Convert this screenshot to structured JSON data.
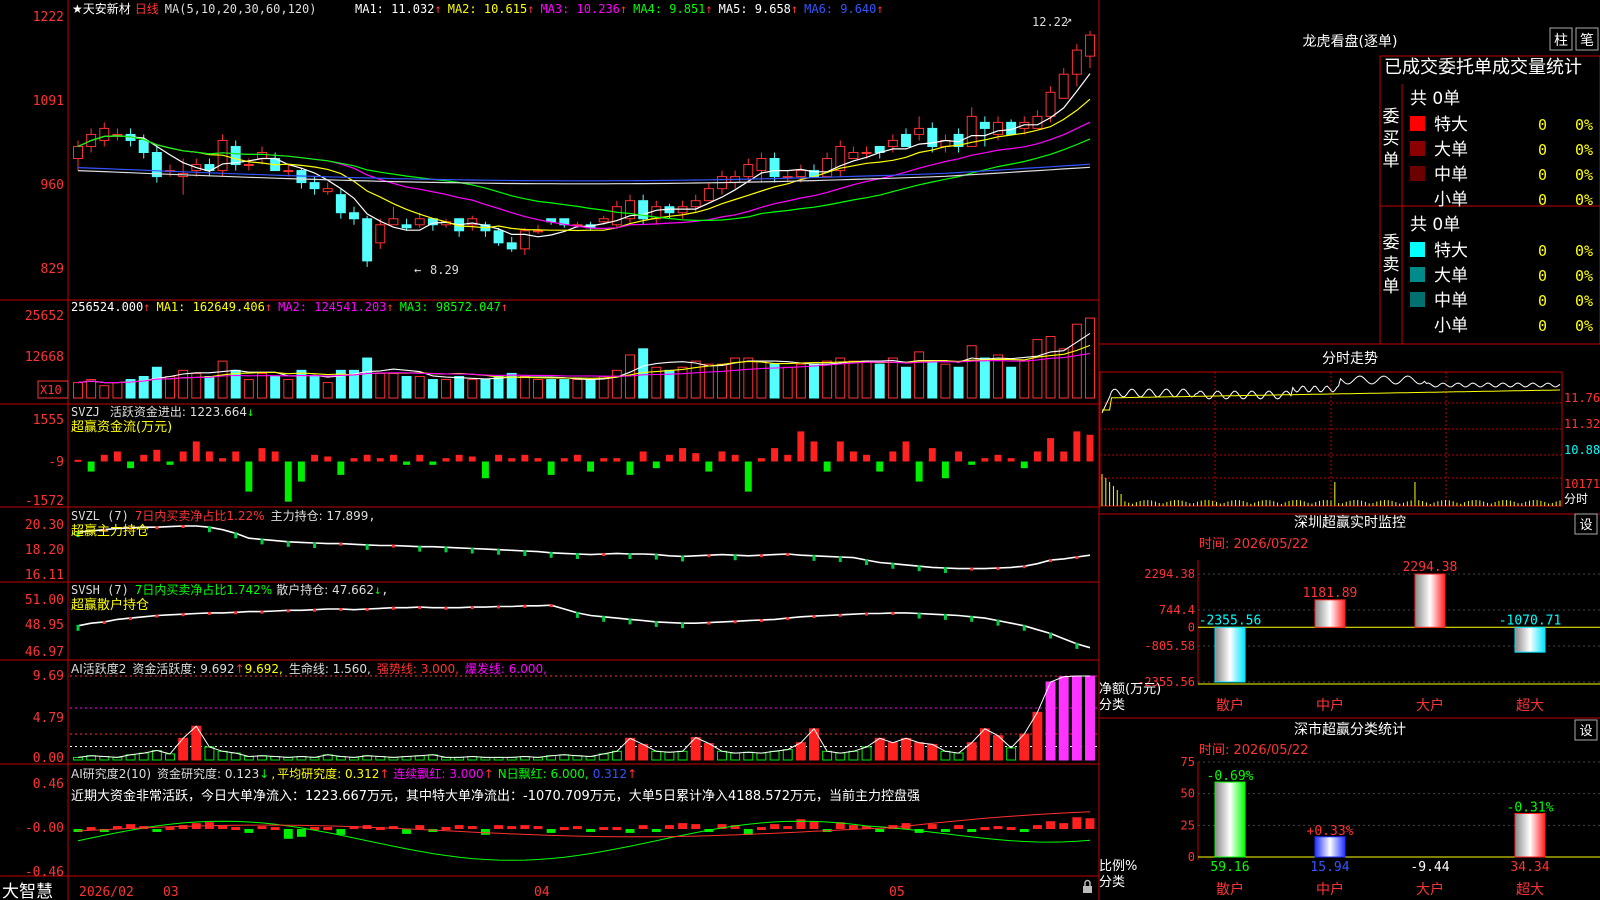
{
  "stock": {
    "name": "★天安新材",
    "period": "日线"
  },
  "main_panel": {
    "indicator": "MA(5,10,20,30,60,120)",
    "ma_labels": [
      {
        "text": "MA1: 11.032",
        "color": "#ffffff"
      },
      {
        "text": "MA2: 10.615",
        "color": "#ffff00"
      },
      {
        "text": "MA3: 10.236",
        "color": "#ff00ff"
      },
      {
        "text": "MA4: 9.851",
        "color": "#00ff00"
      },
      {
        "text": "MA5: 9.658",
        "color": "#ffffff"
      },
      {
        "text": "MA6: 9.640",
        "color": "#3355ff"
      }
    ],
    "high_label": "12.22",
    "low_label": "8.29",
    "y_ticks": [
      "1222",
      "1091",
      "960",
      "829"
    ]
  },
  "vol_panel": {
    "indicator": "VOL(5,10,20)",
    "values": [
      {
        "text": "256524.000",
        "color": "#ffffff"
      },
      {
        "text": "MA1: 162649.406",
        "color": "#ffff00"
      },
      {
        "text": "MA2: 124541.203",
        "color": "#ff00ff"
      },
      {
        "text": "MA3: 98572.047",
        "color": "#00ff00"
      }
    ],
    "y_ticks": [
      "25652",
      "12668"
    ],
    "unit": "X10"
  },
  "svzj_panel": {
    "indicator": "SVZJ",
    "label1": "活跃资金进出: 1223.664",
    "label2": "超赢资金流(万元)",
    "y_ticks": [
      "1555",
      "-9",
      "-1572"
    ]
  },
  "svzl_panel": {
    "indicator": "SVZL (7)",
    "red_text": "7日内买卖净占比1.22%",
    "white_text": "主力持仓: 17.899",
    "label2": "超赢主力持仓",
    "y_ticks": [
      "20.30",
      "18.20",
      "16.11"
    ]
  },
  "svsh_panel": {
    "indicator": "SVSH (7)",
    "green_text": "7日内买卖净占比1.742%",
    "white_text": "散户持仓: 47.662",
    "label2": "超赢散户持仓",
    "y_ticks": [
      "51.00",
      "48.95",
      "46.97"
    ]
  },
  "ai_active_panel": {
    "indicator": "AI活跃度2",
    "t1": "资金活跃度: 9.692",
    "t2": "9.692,",
    "t3": "生命线: 1.560,",
    "t4": "强势线: 3.000,",
    "t5": "爆发线: 6.000,",
    "y_ticks": [
      "9.69",
      "4.79",
      "0.00"
    ]
  },
  "ai_research_panel": {
    "indicator": "AI研究度2(10)",
    "t1": "资金研究度: 0.123",
    "t2": "平均研究度: 0.312",
    "t3": "连续飘红: 3.000",
    "t4": "N日飘红: 6.000,",
    "t5": "0.312",
    "commentary": "近期大资金非常活跃，今日大单净流入：1223.667万元，其中特大单净流出：-1070.709万元，大单5日累计净入4188.572万元，当前主力控盘强",
    "y_ticks": [
      "0.46",
      "-0.00",
      "-0.46"
    ]
  },
  "bottom_axis": {
    "brand": "大智慧",
    "labels": [
      "2026/02",
      "03",
      "04",
      "05"
    ]
  },
  "right_panel": {
    "dragon_title": "龙虎看盘(逐单)",
    "tab_buttons": [
      "柱",
      "笔"
    ],
    "stats_title": "已成交委托单成交量统计",
    "buy_group": {
      "label": "委买单",
      "total": "共 0单",
      "rows": [
        {
          "name": "特大",
          "value": "0",
          "pct": "0%",
          "color": "#ff0000"
        },
        {
          "name": "大单",
          "value": "0",
          "pct": "0%",
          "color": "#8b0000"
        },
        {
          "name": "中单",
          "value": "0",
          "pct": "0%",
          "color": "#6a0000"
        },
        {
          "name": "小单",
          "value": "0",
          "pct": "0%",
          "color": ""
        }
      ]
    },
    "sell_group": {
      "label": "委卖单",
      "total": "共 0单",
      "rows": [
        {
          "name": "特大",
          "value": "0",
          "pct": "0%",
          "color": "#00ffff"
        },
        {
          "name": "大单",
          "value": "0",
          "pct": "0%",
          "color": "#008b8b"
        },
        {
          "name": "中单",
          "value": "0",
          "pct": "0%",
          "color": "#007070"
        },
        {
          "name": "小单",
          "value": "0",
          "pct": "0%",
          "color": ""
        }
      ]
    },
    "intraday_title": "分时走势",
    "intraday_y": [
      "11.76",
      "11.32",
      "10.88"
    ],
    "intraday_vol": "10171",
    "intraday_tag": "分时",
    "sz_monitor": {
      "title": "深圳超赢实时监控",
      "settings": "设",
      "time": "时间: 2026/05/22",
      "y_ticks": [
        "2294.38",
        "744.4",
        "0",
        "-805.58",
        "-2355.56"
      ],
      "label1": "净额(万元)",
      "label2": "分类",
      "bars": [
        {
          "cat": "散户",
          "value": -2355.56,
          "label": "-2355.56"
        },
        {
          "cat": "中户",
          "value": 1181.89,
          "label": "1181.89"
        },
        {
          "cat": "大户",
          "value": 2294.38,
          "label": "2294.38"
        },
        {
          "cat": "超大",
          "value": -1070.71,
          "label": "-1070.71"
        }
      ]
    },
    "sz_class": {
      "title": "深市超赢分类统计",
      "settings": "设",
      "time": "时间: 2026/05/22",
      "y_ticks": [
        "75",
        "50",
        "25",
        "0"
      ],
      "label1": "比例%",
      "label2": "分类",
      "bars": [
        {
          "cat": "散户",
          "value": 59.16,
          "bottom": "59.16",
          "top": "-0.69%"
        },
        {
          "cat": "中户",
          "value": 15.94,
          "bottom": "15.94",
          "top": "+0.33%"
        },
        {
          "cat": "大户",
          "value": -9.44,
          "bottom": "-9.44",
          "top": ""
        },
        {
          "cat": "超大",
          "value": 34.34,
          "bottom": "34.34",
          "top": "-0.31%"
        }
      ]
    }
  },
  "chart_data": {
    "type": "bar",
    "title": "",
    "xlabel": "",
    "ylabel": "",
    "price_range": [
      8.0,
      12.4
    ],
    "candles": [
      [
        10.1,
        10.3,
        10.4,
        9.9
      ],
      [
        10.3,
        10.5,
        10.6,
        10.2
      ],
      [
        10.4,
        10.6,
        10.7,
        10.3
      ],
      [
        10.5,
        10.5,
        10.6,
        10.4
      ],
      [
        10.5,
        10.4,
        10.6,
        10.3
      ],
      [
        10.4,
        10.2,
        10.5,
        10.1
      ],
      [
        10.2,
        9.8,
        10.3,
        9.7
      ],
      [
        9.9,
        9.9,
        10.0,
        9.8
      ],
      [
        9.8,
        9.85,
        10.1,
        9.5
      ],
      [
        9.9,
        10.0,
        10.1,
        9.8
      ],
      [
        10.0,
        9.9,
        10.1,
        9.8
      ],
      [
        9.9,
        10.4,
        10.5,
        9.8
      ],
      [
        10.3,
        10.0,
        10.4,
        9.9
      ],
      [
        10.0,
        10.0,
        10.1,
        9.9
      ],
      [
        10.1,
        10.2,
        10.3,
        10.0
      ],
      [
        10.1,
        9.9,
        10.2,
        9.9
      ],
      [
        9.9,
        9.9,
        10.0,
        9.8
      ],
      [
        9.9,
        9.7,
        9.95,
        9.6
      ],
      [
        9.7,
        9.6,
        9.8,
        9.5
      ],
      [
        9.55,
        9.6,
        9.7,
        9.5
      ],
      [
        9.5,
        9.2,
        9.6,
        9.1
      ],
      [
        9.2,
        9.1,
        9.3,
        9.0
      ],
      [
        9.1,
        8.4,
        9.15,
        8.3
      ],
      [
        8.7,
        9.0,
        9.1,
        8.6
      ],
      [
        9.0,
        9.1,
        9.3,
        9.0
      ],
      [
        9.0,
        8.95,
        9.1,
        8.9
      ],
      [
        9.0,
        9.1,
        9.2,
        8.95
      ],
      [
        9.1,
        9.0,
        9.1,
        8.9
      ],
      [
        9.0,
        9.05,
        9.1,
        8.95
      ],
      [
        9.1,
        8.9,
        9.1,
        8.8
      ],
      [
        9.0,
        9.1,
        9.15,
        8.9
      ],
      [
        9.0,
        8.9,
        9.05,
        8.8
      ],
      [
        8.9,
        8.7,
        8.95,
        8.65
      ],
      [
        8.7,
        8.6,
        8.8,
        8.55
      ],
      [
        8.6,
        8.9,
        8.95,
        8.5
      ],
      [
        8.9,
        8.9,
        9.0,
        8.85
      ],
      [
        9.1,
        9.05,
        9.1,
        9.0
      ],
      [
        9.1,
        9.0,
        9.1,
        8.95
      ],
      [
        9.0,
        9.0,
        9.05,
        8.95
      ],
      [
        9.0,
        8.95,
        9.05,
        8.9
      ],
      [
        9.05,
        9.1,
        9.15,
        9.0
      ],
      [
        9.0,
        9.3,
        9.4,
        8.95
      ],
      [
        9.1,
        9.4,
        9.5,
        9.0
      ],
      [
        9.4,
        9.1,
        9.5,
        9.0
      ],
      [
        9.1,
        9.3,
        9.4,
        9.0
      ],
      [
        9.3,
        9.2,
        9.35,
        9.1
      ],
      [
        9.2,
        9.3,
        9.4,
        9.1
      ],
      [
        9.3,
        9.4,
        9.5,
        9.2
      ],
      [
        9.4,
        9.6,
        9.7,
        9.4
      ],
      [
        9.6,
        9.8,
        9.9,
        9.5
      ],
      [
        9.7,
        9.8,
        9.9,
        9.6
      ],
      [
        9.8,
        10.0,
        10.1,
        9.7
      ],
      [
        9.9,
        10.1,
        10.2,
        9.7
      ],
      [
        10.1,
        9.8,
        10.2,
        9.7
      ],
      [
        9.8,
        9.8,
        9.9,
        9.7
      ],
      [
        9.8,
        9.9,
        10.0,
        9.7
      ],
      [
        9.9,
        9.8,
        10.0,
        9.8
      ],
      [
        9.8,
        10.1,
        10.2,
        9.8
      ],
      [
        9.9,
        10.3,
        10.4,
        9.8
      ],
      [
        10.1,
        10.2,
        10.3,
        10.1
      ],
      [
        10.2,
        10.2,
        10.3,
        10.1
      ],
      [
        10.3,
        10.2,
        10.3,
        10.1
      ],
      [
        10.3,
        10.4,
        10.5,
        10.2
      ],
      [
        10.5,
        10.3,
        10.6,
        10.3
      ],
      [
        10.5,
        10.6,
        10.8,
        10.4
      ],
      [
        10.6,
        10.3,
        10.7,
        10.2
      ],
      [
        10.3,
        10.4,
        10.5,
        10.2
      ],
      [
        10.5,
        10.3,
        10.6,
        10.2
      ],
      [
        10.3,
        10.8,
        10.95,
        10.3
      ],
      [
        10.7,
        10.6,
        10.8,
        10.3
      ],
      [
        10.5,
        10.7,
        10.8,
        10.4
      ],
      [
        10.7,
        10.5,
        10.75,
        10.5
      ],
      [
        10.6,
        10.7,
        10.8,
        10.5
      ],
      [
        10.6,
        10.8,
        10.9,
        10.6
      ],
      [
        10.8,
        11.2,
        11.3,
        10.7
      ],
      [
        11.1,
        11.5,
        11.6,
        11.1
      ],
      [
        11.5,
        11.9,
        12.0,
        11.3
      ],
      [
        11.8,
        12.15,
        12.22,
        11.6
      ]
    ],
    "volumes": [
      0.5,
      0.6,
      0.4,
      0.5,
      0.6,
      0.7,
      1.0,
      0.7,
      0.9,
      0.8,
      0.7,
      1.2,
      0.9,
      0.6,
      0.8,
      0.7,
      0.6,
      0.9,
      0.7,
      0.5,
      0.9,
      0.9,
      1.3,
      0.8,
      0.8,
      0.7,
      0.7,
      0.6,
      0.6,
      0.7,
      0.6,
      0.6,
      0.7,
      0.8,
      0.7,
      0.6,
      0.6,
      0.6,
      0.6,
      0.6,
      0.7,
      0.9,
      1.4,
      1.6,
      1.0,
      0.9,
      1.0,
      1.2,
      1.1,
      1.1,
      1.3,
      1.3,
      1.2,
      1.1,
      1.0,
      1.1,
      1.1,
      1.2,
      1.3,
      1.2,
      1.2,
      1.1,
      1.3,
      1.0,
      1.5,
      1.2,
      1.1,
      1.0,
      1.7,
      1.3,
      1.4,
      1.0,
      1.2,
      1.9,
      2.0,
      1.6,
      2.4,
      2.6
    ],
    "svzj": [
      0.05,
      -0.3,
      0.2,
      0.3,
      -0.2,
      0.2,
      0.35,
      -0.1,
      0.3,
      0.6,
      0.3,
      0.1,
      0.3,
      -0.9,
      0.4,
      0.3,
      -1.2,
      -0.6,
      0.2,
      0.15,
      -0.4,
      0.1,
      0.2,
      0.1,
      0.2,
      -0.1,
      0.2,
      -0.1,
      0.1,
      0.2,
      0.15,
      -0.5,
      0.2,
      0.1,
      0.2,
      0.1,
      -0.4,
      0.1,
      0.2,
      -0.3,
      0.1,
      0.1,
      -0.4,
      0.3,
      -0.2,
      0.2,
      0.4,
      0.25,
      -0.3,
      0.3,
      0.2,
      -0.9,
      0.1,
      0.4,
      0.2,
      0.9,
      0.6,
      -0.3,
      0.6,
      0.3,
      0.2,
      -0.3,
      0.3,
      0.6,
      -0.6,
      0.4,
      -0.5,
      0.3,
      -0.1,
      0.1,
      0.2,
      0.1,
      -0.2,
      0.3,
      0.7,
      0.3,
      0.9,
      0.8
    ],
    "svzl": [
      19.8,
      19.9,
      20.0,
      20.1,
      20.15,
      20.2,
      20.2,
      20.25,
      20.3,
      20.3,
      20.2,
      20.0,
      19.7,
      19.3,
      19.2,
      19.1,
      19.0,
      18.95,
      18.9,
      18.85,
      18.85,
      18.8,
      18.75,
      18.7,
      18.7,
      18.65,
      18.6,
      18.6,
      18.55,
      18.5,
      18.45,
      18.4,
      18.35,
      18.3,
      18.25,
      18.2,
      18.1,
      18.05,
      18.0,
      17.95,
      18.0,
      18.05,
      18.0,
      18.0,
      17.95,
      17.85,
      17.8,
      17.85,
      17.9,
      17.95,
      17.9,
      17.85,
      17.9,
      17.95,
      18.0,
      17.9,
      17.85,
      17.8,
      17.75,
      17.7,
      17.5,
      17.3,
      17.2,
      17.1,
      17.0,
      16.9,
      16.85,
      16.8,
      16.8,
      16.8,
      16.85,
      16.9,
      17.0,
      17.2,
      17.5,
      17.6,
      17.75,
      17.9
    ],
    "svsh": [
      49.0,
      49.2,
      49.3,
      49.5,
      49.6,
      49.7,
      49.8,
      49.85,
      49.9,
      49.95,
      50.0,
      50.0,
      50.05,
      50.1,
      50.1,
      50.15,
      50.2,
      50.2,
      50.25,
      50.3,
      50.3,
      50.25,
      50.3,
      50.35,
      50.4,
      50.4,
      50.45,
      50.4,
      50.4,
      50.4,
      50.45,
      50.45,
      50.5,
      50.5,
      50.55,
      50.55,
      50.6,
      50.3,
      50.0,
      49.8,
      49.7,
      49.6,
      49.5,
      49.4,
      49.3,
      49.25,
      49.2,
      49.2,
      49.25,
      49.3,
      49.35,
      49.4,
      49.45,
      49.5,
      49.6,
      49.7,
      49.75,
      49.8,
      49.85,
      49.9,
      49.95,
      49.95,
      50.0,
      50.0,
      49.95,
      49.9,
      49.85,
      49.8,
      49.7,
      49.6,
      49.4,
      49.2,
      49.0,
      48.7,
      48.4,
      48.0,
      47.6,
      47.3
    ],
    "ai_active": [
      0.3,
      0.5,
      0.4,
      0.3,
      0.6,
      0.8,
      1.1,
      0.7,
      2.5,
      3.9,
      1.5,
      1.0,
      0.8,
      0.4,
      0.5,
      0.4,
      0.3,
      0.4,
      0.3,
      0.6,
      0.4,
      0.3,
      0.5,
      0.4,
      0.3,
      0.4,
      0.5,
      0.6,
      0.3,
      0.3,
      0.4,
      0.3,
      0.3,
      0.3,
      0.4,
      0.3,
      0.5,
      0.6,
      0.5,
      0.4,
      0.7,
      1.0,
      2.5,
      1.8,
      1.0,
      0.9,
      1.0,
      2.6,
      1.9,
      1.0,
      0.8,
      0.9,
      0.8,
      1.0,
      1.2,
      2.0,
      3.6,
      1.0,
      0.8,
      1.0,
      1.5,
      2.5,
      2.0,
      2.5,
      2.0,
      1.8,
      1.0,
      0.8,
      2.0,
      3.6,
      2.8,
      1.4,
      3.0,
      5.5,
      9.0,
      9.6,
      9.69,
      9.69
    ],
    "ai_research": [
      -0.03,
      0.02,
      -0.02,
      0.03,
      0.05,
      0.03,
      -0.03,
      0.02,
      0.04,
      0.06,
      0.07,
      0.04,
      0.02,
      -0.04,
      0.03,
      0.02,
      -0.1,
      -0.08,
      0.02,
      0.02,
      -0.06,
      0.03,
      0.04,
      0.02,
      0.03,
      -0.05,
      0.04,
      -0.03,
      0.02,
      0.04,
      0.03,
      -0.06,
      0.04,
      0.03,
      0.04,
      0.03,
      -0.04,
      0.02,
      0.03,
      -0.03,
      0.02,
      0.02,
      -0.04,
      0.04,
      -0.02,
      0.04,
      0.06,
      0.05,
      -0.03,
      0.05,
      0.04,
      -0.06,
      0.02,
      0.05,
      0.03,
      0.1,
      0.08,
      -0.03,
      0.07,
      0.04,
      0.03,
      -0.02,
      0.04,
      0.06,
      -0.04,
      0.05,
      -0.03,
      0.04,
      -0.02,
      0.02,
      0.03,
      0.02,
      -0.02,
      0.04,
      0.08,
      0.06,
      0.12,
      0.11
    ]
  }
}
